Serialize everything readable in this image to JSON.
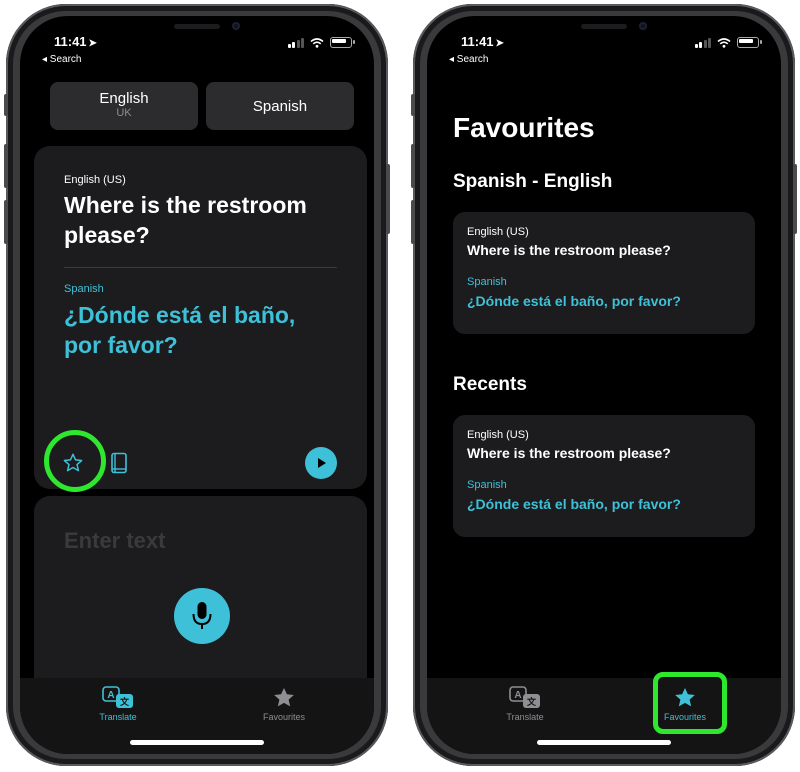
{
  "colors": {
    "accent": "#3ec1d8",
    "highlight": "#2ee82e",
    "card": "#1c1c1e",
    "background": "#000000"
  },
  "status": {
    "time": "11:41",
    "back_label": "◂ Search"
  },
  "translate_screen": {
    "lang_source": {
      "name": "English",
      "region": "UK"
    },
    "lang_target": {
      "name": "Spanish"
    },
    "card": {
      "source_lang": "English (US)",
      "source_text": "Where is the restroom please?",
      "target_lang": "Spanish",
      "target_text": "¿Dónde está el baño, por favor?"
    },
    "input_placeholder": "Enter text"
  },
  "favourites_screen": {
    "title": "Favourites",
    "favourites_section": "Spanish - English",
    "favourite_item": {
      "source_lang": "English (US)",
      "source_text": "Where is the restroom please?",
      "target_lang": "Spanish",
      "target_text": "¿Dónde está el baño, por favor?"
    },
    "recents_section": "Recents",
    "recent_item": {
      "source_lang": "English (US)",
      "source_text": "Where is the restroom please?",
      "target_lang": "Spanish",
      "target_text": "¿Dónde está el baño, por favor?"
    }
  },
  "tabs": {
    "translate": "Translate",
    "favourites": "Favourites"
  }
}
